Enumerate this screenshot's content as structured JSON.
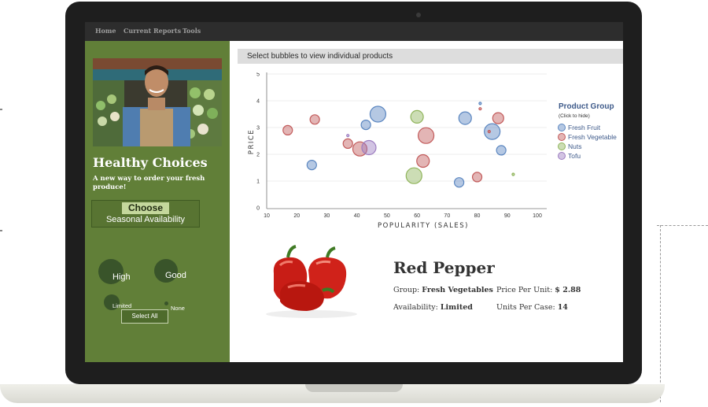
{
  "nav": {
    "items": [
      "Home",
      "Current Reports",
      "Tools"
    ]
  },
  "sidebar": {
    "title": "Healthy Choices",
    "subtitle": "A new way to order your fresh produce!",
    "choose_label": "Choose",
    "seasonal_label": "Seasonal Availability",
    "availability": [
      {
        "label": "High"
      },
      {
        "label": "Good"
      },
      {
        "label": "Limited"
      },
      {
        "label": "None"
      }
    ],
    "select_all": "Select All"
  },
  "instruction": "Select bubbles to view individual products",
  "legend": {
    "title": "Product Group",
    "hint": "(Click to hide)",
    "items": [
      {
        "label": "Fresh Fruit",
        "color": "#5b86c0"
      },
      {
        "label": "Fresh Vegetable",
        "color": "#c25a5a"
      },
      {
        "label": "Nuts",
        "color": "#8fb45a"
      },
      {
        "label": "Tofu",
        "color": "#9c7cc0"
      }
    ]
  },
  "chart_data": {
    "type": "scatter",
    "xlabel": "POPULARITY (SALES)",
    "ylabel": "PRICE",
    "xlim": [
      10,
      100
    ],
    "ylim": [
      0,
      5
    ],
    "xticks": [
      10,
      20,
      30,
      40,
      50,
      60,
      70,
      80,
      90,
      100
    ],
    "yticks": [
      0,
      1,
      2,
      3,
      4,
      5
    ],
    "series": [
      {
        "name": "Fresh Fruit",
        "color": "#5b86c0",
        "points": [
          {
            "x": 47,
            "y": 3.5,
            "r": 10
          },
          {
            "x": 43,
            "y": 3.1,
            "r": 6
          },
          {
            "x": 25,
            "y": 1.6,
            "r": 6
          },
          {
            "x": 76,
            "y": 3.35,
            "r": 8
          },
          {
            "x": 85,
            "y": 2.85,
            "r": 10
          },
          {
            "x": 88,
            "y": 2.15,
            "r": 6
          },
          {
            "x": 74,
            "y": 0.95,
            "r": 6
          },
          {
            "x": 81,
            "y": 3.9,
            "r": 1.5
          }
        ]
      },
      {
        "name": "Fresh Vegetable",
        "color": "#c25a5a",
        "points": [
          {
            "x": 17,
            "y": 2.9,
            "r": 6
          },
          {
            "x": 26,
            "y": 3.3,
            "r": 6
          },
          {
            "x": 37,
            "y": 2.4,
            "r": 6
          },
          {
            "x": 41,
            "y": 2.2,
            "r": 9
          },
          {
            "x": 63,
            "y": 2.7,
            "r": 10
          },
          {
            "x": 62,
            "y": 1.75,
            "r": 8
          },
          {
            "x": 87,
            "y": 3.35,
            "r": 7
          },
          {
            "x": 80,
            "y": 1.15,
            "r": 6
          },
          {
            "x": 81,
            "y": 3.7,
            "r": 1.5
          },
          {
            "x": 84,
            "y": 2.85,
            "r": 1.5
          }
        ]
      },
      {
        "name": "Nuts",
        "color": "#8fb45a",
        "points": [
          {
            "x": 60,
            "y": 3.4,
            "r": 8
          },
          {
            "x": 59,
            "y": 1.2,
            "r": 10
          },
          {
            "x": 92,
            "y": 1.25,
            "r": 1.5
          }
        ]
      },
      {
        "name": "Tofu",
        "color": "#9c7cc0",
        "points": [
          {
            "x": 44,
            "y": 2.25,
            "r": 9
          },
          {
            "x": 37,
            "y": 2.7,
            "r": 1.5
          }
        ]
      }
    ]
  },
  "product": {
    "name": "Red Pepper",
    "group_label": "Group:",
    "group_value": "Fresh Vegetables",
    "price_label": "Price Per Unit:",
    "price_value": "$ 2.88",
    "availability_label": "Availability:",
    "availability_value": "Limited",
    "units_label": "Units Per Case:",
    "units_value": "14"
  }
}
